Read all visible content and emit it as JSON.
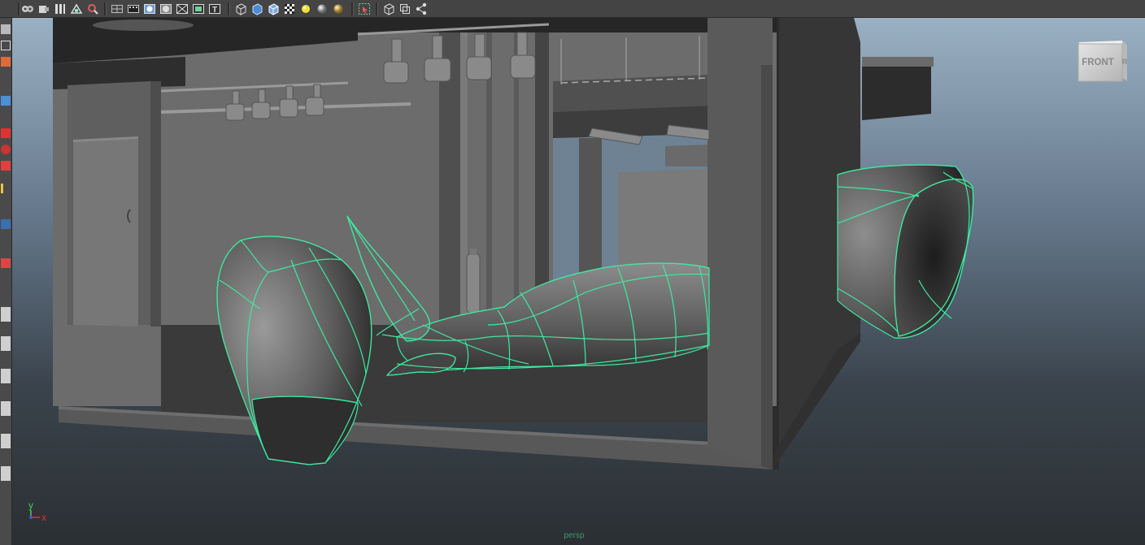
{
  "viewport": {
    "camera_label": "persp",
    "view_cube": {
      "face_label": "FRONT",
      "side_label": "R"
    },
    "axis_indicator": {
      "x_label": "x",
      "y_label": "y"
    },
    "wireframe_color": "#3fe8a2",
    "background_top": "#9ab0c3",
    "background_bottom": "#2b2f33"
  },
  "toolbar": {
    "icons": [
      "camera-select-icon",
      "camera-attributes-icon",
      "bookmarks-icon",
      "image-plane-icon",
      "grease-pencil-icon",
      "grid-icon",
      "film-gate-icon",
      "resolution-gate-icon",
      "gate-mask-icon",
      "field-chart-icon",
      "safe-action-icon",
      "safe-title-icon",
      "wireframe-icon",
      "smooth-shade-icon",
      "wireframe-on-shaded-icon",
      "textured-icon",
      "use-all-lights-icon",
      "shadows-icon",
      "screen-space-ao-icon",
      "isolate-select-icon",
      "xray-icon",
      "xray-joints-icon",
      "xray-components-icon"
    ]
  },
  "left_strip": {
    "tools": [
      "select-tool-icon",
      "lasso-tool-icon",
      "paint-select-icon",
      "move-tool-icon",
      "rotate-tool-icon",
      "scale-tool-icon",
      "show-manipulator-icon",
      "soft-select-icon",
      "last-tool-icon",
      "layout-single-icon",
      "layout-four-icon",
      "layout-side-icon",
      "layout-outliner-icon",
      "layout-graph-icon",
      "layout-hypershade-icon",
      "layout-uv-icon"
    ]
  }
}
